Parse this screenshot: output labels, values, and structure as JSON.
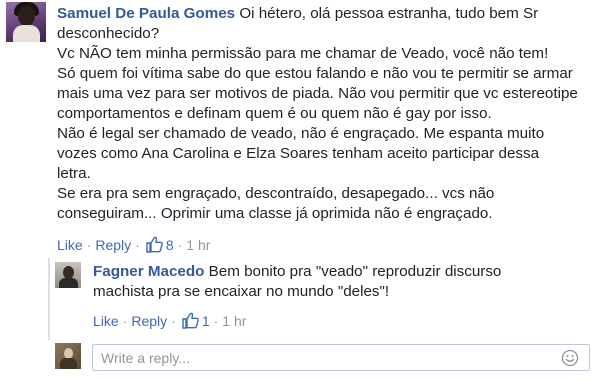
{
  "main_comment": {
    "author": "Samuel De Paula Gomes",
    "text": " Oi hétero, olá pessoa estranha, tudo bem Sr\ndesconhecido?\nVc NÃO tem minha permissão para me chamar de Veado, você não tem!\nSó quem foi vítima sabe do que estou falando e não vou te permitir se armar\nmais uma vez para ser motivos de piada. Não vou permitir que vc estereotipe\ncomportamentos e definam quem é ou quem não é gay por isso.\nNão é legal ser chamado de veado, não é engraçado. Me espanta muito\nvozes como Ana Carolina e Elza Soares tenham aceito participar dessa\nletra.\nSe era pra sem engraçado, descontraído, desapegado... vcs não\nconseguiram... Oprimir uma classe já oprimida não é engraçado.",
    "actions": {
      "like": "Like",
      "reply": "Reply",
      "like_count": "8",
      "time": "1 hr"
    }
  },
  "reply_comment": {
    "author": "Fagner Macedo",
    "text": " Bem bonito pra \"veado\" reproduzir discurso\nmachista pra se encaixar no mundo \"deles\"!",
    "actions": {
      "like": "Like",
      "reply": "Reply",
      "like_count": "1",
      "time": "1 hr"
    }
  },
  "reply_box": {
    "placeholder": "Write a reply...",
    "icon": "smiley-icon"
  },
  "icons": {
    "like": "thumbs-up-icon"
  },
  "colors": {
    "author": "#365899",
    "link": "#4267b2",
    "muted": "#90949c",
    "text": "#1d2129"
  }
}
